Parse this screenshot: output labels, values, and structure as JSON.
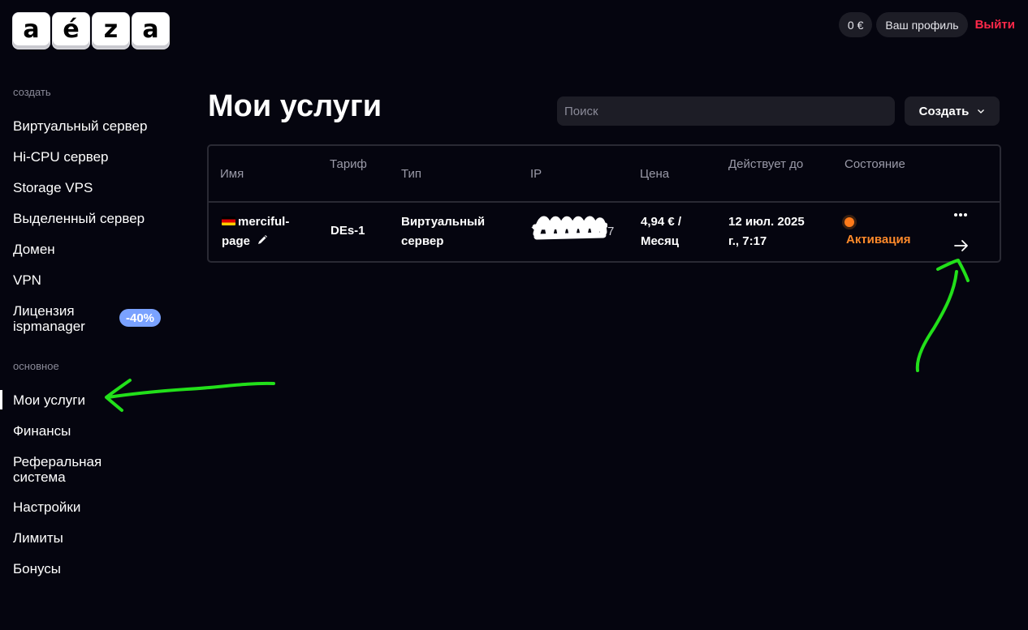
{
  "logo": {
    "letters": [
      "a",
      "é",
      "z",
      "a"
    ]
  },
  "header": {
    "balance": "0 €",
    "profile": "Ваш профиль",
    "logout": "Выйти"
  },
  "sidebar": {
    "create_title": "создать",
    "create_items": [
      "Виртуальный сервер",
      "Hi-CPU сервер",
      "Storage VPS",
      "Выделенный сервер",
      "Домен",
      "VPN"
    ],
    "license_line1": "Лицензия",
    "license_line2": "ispmanager",
    "license_badge": "-40%",
    "main_title": "основное",
    "main_items": [
      "Мои услуги",
      "Финансы"
    ],
    "referral_line1": "Реферальная",
    "referral_line2": "система",
    "main_items_2": [
      "Настройки",
      "Лимиты",
      "Бонусы"
    ]
  },
  "main": {
    "title": "Мои услуги",
    "search_placeholder": "Поиск",
    "create_button": "Создать"
  },
  "table": {
    "headers": [
      "Имя",
      "Тариф",
      "Тип",
      "IP",
      "Цена",
      "Действует до",
      "Состояние"
    ],
    "row": {
      "name_line1": "merciful-",
      "name_line2": "page",
      "tariff": "DEs-1",
      "type_line1": "Виртуальный",
      "type_line2": "сервер",
      "ip_start": "7",
      "ip_end": "7",
      "price_line1": "4,94 € /",
      "price_line2": "Месяц",
      "valid_line1": "12 июл. 2025",
      "valid_line2": "г., 7:17",
      "status": "Активация"
    }
  },
  "colors": {
    "background": "#05050f",
    "accent_red": "#ff2849",
    "status_orange": "#ff8a2a",
    "badge_blue": "#7aa2ff",
    "annotation_green": "#22e01a"
  }
}
